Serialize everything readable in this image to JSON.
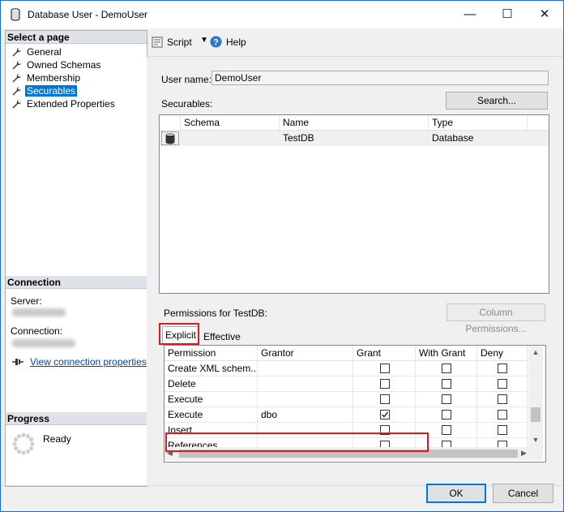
{
  "window": {
    "title": "Database User - DemoUser",
    "minimize": "—",
    "maximize": "☐",
    "close": "✕"
  },
  "left": {
    "select_page_header": "Select a page",
    "pages": [
      {
        "label": "General",
        "selected": false
      },
      {
        "label": "Owned Schemas",
        "selected": false
      },
      {
        "label": "Membership",
        "selected": false
      },
      {
        "label": "Securables",
        "selected": true
      },
      {
        "label": "Extended Properties",
        "selected": false
      }
    ],
    "connection_header": "Connection",
    "server_label": "Server:",
    "connection_label": "Connection:",
    "view_connection_link": "View connection properties",
    "progress_header": "Progress",
    "progress_status": "Ready"
  },
  "toolbar": {
    "script_label": "Script",
    "help_label": "Help"
  },
  "form": {
    "user_name_label": "User name:",
    "user_name_value": "DemoUser",
    "securables_label": "Securables:",
    "search_button": "Search...",
    "securables_columns": [
      "Schema",
      "Name",
      "Type"
    ],
    "securables_rows": [
      {
        "schema": "",
        "name": "TestDB",
        "type": "Database"
      }
    ],
    "permissions_label": "Permissions for TestDB:",
    "column_permissions_button": "Column Permissions...",
    "tabs": [
      "Explicit",
      "Effective"
    ],
    "perm_columns": [
      "Permission",
      "Grantor",
      "Grant",
      "With Grant",
      "Deny"
    ],
    "perm_rows": [
      {
        "permission": "Create XML schem...",
        "grantor": "",
        "grant": false,
        "with_grant": false,
        "deny": false
      },
      {
        "permission": "Delete",
        "grantor": "",
        "grant": false,
        "with_grant": false,
        "deny": false
      },
      {
        "permission": "Execute",
        "grantor": "",
        "grant": false,
        "with_grant": false,
        "deny": false
      },
      {
        "permission": "Execute",
        "grantor": "dbo",
        "grant": true,
        "with_grant": false,
        "deny": false
      },
      {
        "permission": "Insert",
        "grantor": "",
        "grant": false,
        "with_grant": false,
        "deny": false
      },
      {
        "permission": "References",
        "grantor": "",
        "grant": false,
        "with_grant": false,
        "deny": false
      }
    ]
  },
  "footer": {
    "ok_button": "OK",
    "cancel_button": "Cancel"
  },
  "icons": {
    "database": "database-icon",
    "wrench": "wrench-icon",
    "help": "help-icon",
    "connection": "connection-icon",
    "spinner": "spinner-icon"
  },
  "colors": {
    "selection": "#0078d7",
    "highlight": "#d81b1b",
    "link": "#0645ad"
  }
}
